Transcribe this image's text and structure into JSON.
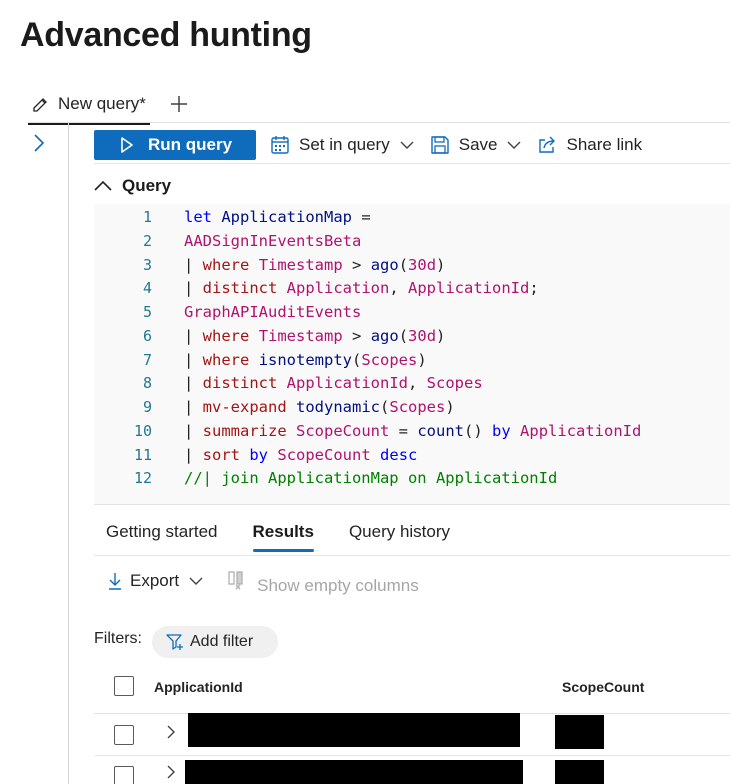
{
  "page": {
    "title": "Advanced hunting"
  },
  "tabs": [
    {
      "label": "New query*",
      "icon": "edit-pen-icon",
      "active": true
    }
  ],
  "toolbar": {
    "run_label": "Run query",
    "set_in_query_label": "Set in query",
    "save_label": "Save",
    "share_label": "Share link"
  },
  "query_section": {
    "label": "Query",
    "expanded": true
  },
  "editor": {
    "lines": [
      {
        "num": "1"
      },
      {
        "num": "2"
      },
      {
        "num": "3"
      },
      {
        "num": "4"
      },
      {
        "num": "5"
      },
      {
        "num": "6"
      },
      {
        "num": "7"
      },
      {
        "num": "8"
      },
      {
        "num": "9"
      },
      {
        "num": "10"
      },
      {
        "num": "11"
      },
      {
        "num": "12"
      }
    ],
    "tokens": {
      "l1": [
        "let",
        " ApplicationMap ",
        "="
      ],
      "l2": [
        "AADSignInEventsBeta"
      ],
      "l3": [
        "| ",
        "where",
        " ",
        "Timestamp",
        " > ",
        "ago",
        "(",
        "30d",
        ")"
      ],
      "l4": [
        "| ",
        "distinct",
        " ",
        "Application",
        ", ",
        "ApplicationId",
        ";"
      ],
      "l5": [
        "GraphAPIAuditEvents"
      ],
      "l6": [
        "| ",
        "where",
        " ",
        "Timestamp",
        " > ",
        "ago",
        "(",
        "30d",
        ")"
      ],
      "l7": [
        "| ",
        "where",
        " ",
        "isnotempty",
        "(",
        "Scopes",
        ")"
      ],
      "l8": [
        "| ",
        "distinct",
        " ",
        "ApplicationId",
        ", ",
        "Scopes"
      ],
      "l9": [
        "| ",
        "mv-expand",
        " ",
        "todynamic",
        "(",
        "Scopes",
        ")"
      ],
      "l10": [
        "| ",
        "summarize",
        " ",
        "ScopeCount",
        " = ",
        "count",
        "() ",
        "by",
        " ",
        "ApplicationId"
      ],
      "l11": [
        "| ",
        "sort",
        " ",
        "by",
        " ",
        "ScopeCount",
        " ",
        "desc"
      ],
      "l12": [
        "//| join ApplicationMap on ApplicationId"
      ]
    }
  },
  "result_tabs": [
    {
      "label": "Getting started",
      "active": false
    },
    {
      "label": "Results",
      "active": true
    },
    {
      "label": "Query history",
      "active": false
    }
  ],
  "results_toolbar": {
    "export_label": "Export",
    "empty_columns_label": "Show empty columns"
  },
  "filters": {
    "label": "Filters:",
    "add_filter_label": "Add filter"
  },
  "grid": {
    "columns": [
      "ApplicationId",
      "ScopeCount"
    ],
    "rows": [
      {
        "application_id": "",
        "scope_count": "",
        "redacted": true
      },
      {
        "application_id": "",
        "scope_count": "",
        "redacted": true
      }
    ]
  },
  "colors": {
    "accent": "#0f6cbd",
    "keyword": "#0000ff",
    "table": "#a31515",
    "function": "#001080",
    "comment": "#008000",
    "line_number": "#237893"
  }
}
